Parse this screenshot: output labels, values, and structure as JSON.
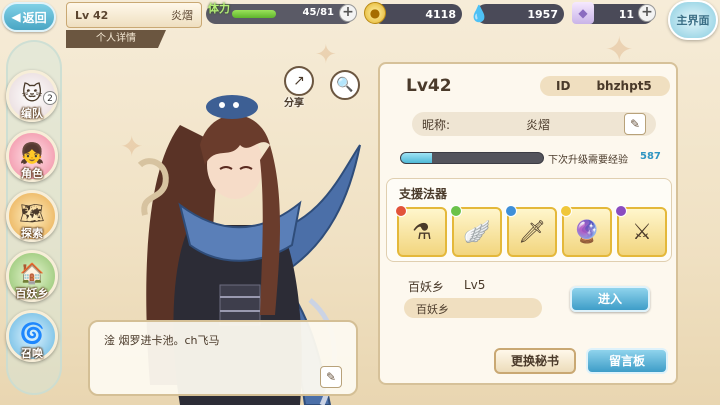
{
  "colors": {
    "accent_blue": "#4fb9d6",
    "panel_bg": "#fdf8ee",
    "brown_text": "#4a3a2a",
    "gold": "#e4b83a"
  },
  "topbar": {
    "back_label": "返回",
    "level": "Lv 42",
    "player_name": "炎熠",
    "detail_tab": "个人详情",
    "stamina_label": "体力",
    "stamina_value": "45/81",
    "stamina_fraction": 0.56,
    "gold": "4118",
    "gems": "1957",
    "tickets": "11",
    "main_label": "主界面",
    "gold_icon": "coin-icon",
    "gem_icon": "water-drop-icon",
    "ticket_icon": "crystal-icon"
  },
  "nav": {
    "items": [
      {
        "label": "编队",
        "icon": "team-icon",
        "badge": "2"
      },
      {
        "label": "角色",
        "icon": "character-icon"
      },
      {
        "label": "探索",
        "icon": "explore-icon"
      },
      {
        "label": "百妖乡",
        "icon": "village-icon"
      },
      {
        "label": "召唤",
        "icon": "summon-icon"
      }
    ]
  },
  "actions": {
    "share_label": "分享",
    "share_icon": "share-icon",
    "search_icon": "magnifier-icon"
  },
  "speech": {
    "text": "淦 烟罗进卡池。ch飞马"
  },
  "profile": {
    "level": "Lv42",
    "id_label": "ID",
    "id_value": "bhzhpt5",
    "nickname_label": "昵称:",
    "nickname_value": "炎熠",
    "exp_fraction": 0.22,
    "exp_text": "下次升级需要经验",
    "exp_needed": "587",
    "support_title": "支援法器",
    "village_name": "百妖乡",
    "village_level": "Lv5",
    "village_pill": "百妖乡",
    "enter_label": "进入",
    "swap_label": "更换秘书",
    "message_label": "留言板"
  }
}
